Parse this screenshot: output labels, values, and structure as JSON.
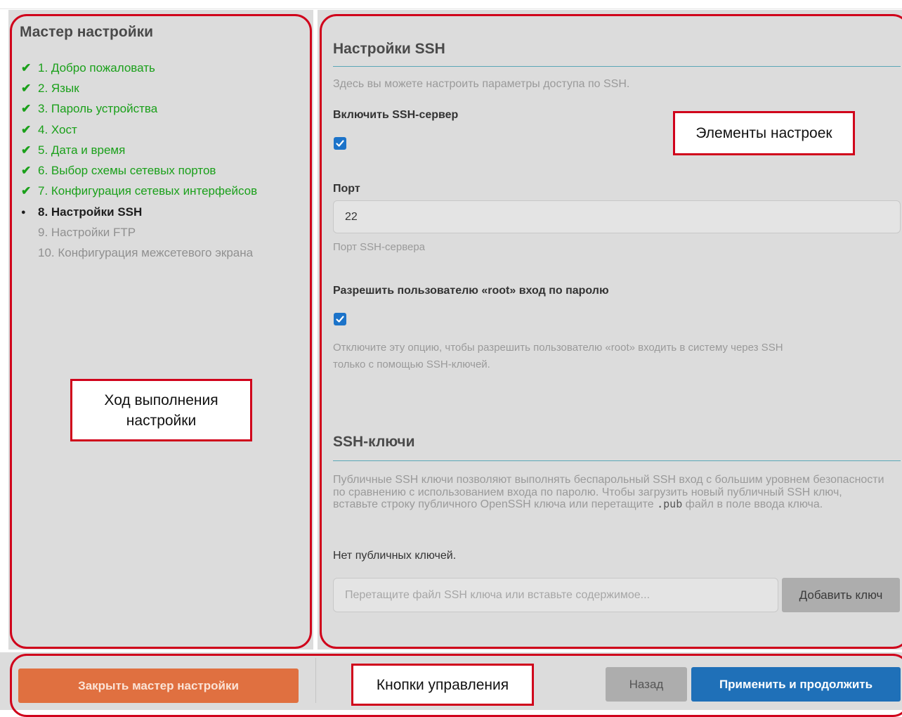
{
  "sidebar": {
    "title": "Мастер настройки",
    "steps": [
      {
        "label": "1. Добро пожаловать",
        "status": "done",
        "marker": "✔"
      },
      {
        "label": "2. Язык",
        "status": "done",
        "marker": "✔"
      },
      {
        "label": "3. Пароль устройства",
        "status": "done",
        "marker": "✔"
      },
      {
        "label": "4. Хост",
        "status": "done",
        "marker": "✔"
      },
      {
        "label": "5. Дата и время",
        "status": "done",
        "marker": "✔"
      },
      {
        "label": "6. Выбор схемы сетевых портов",
        "status": "done",
        "marker": "✔"
      },
      {
        "label": "7. Конфигурация сетевых интерфейсов",
        "status": "done",
        "marker": "✔"
      },
      {
        "label": "8. Настройки SSH",
        "status": "current",
        "marker": "●"
      },
      {
        "label": "9. Настройки FTP",
        "status": "todo",
        "marker": ""
      },
      {
        "label": "10. Конфигурация межсетевого экрана",
        "status": "todo",
        "marker": ""
      }
    ]
  },
  "ssh": {
    "title": "Настройки SSH",
    "description": "Здесь вы можете настроить параметры доступа по SSH.",
    "enable_label": "Включить SSH-сервер",
    "enable_checked": true,
    "port_label": "Порт",
    "port_value": "22",
    "port_hint": "Порт SSH-сервера",
    "root_label": "Разрешить пользователю «root» вход по паролю",
    "root_checked": true,
    "root_hint_line1": "Отключите эту опцию, чтобы разрешить пользователю «root» входить в систему через SSH",
    "root_hint_line2": "только с помощью SSH-ключей."
  },
  "keys": {
    "title": "SSH-ключи",
    "para_before": "Публичные SSH ключи позволяют выполнять беспарольный SSH вход с большим уровнем безопасности по сравнению с использованием входа по паролю. Чтобы загрузить новый публичный SSH ключ, вставьте строку публичного OpenSSH ключа или перетащите ",
    "para_code": ".pub",
    "para_after": " файл в поле ввода ключа.",
    "empty_text": "Нет публичных ключей.",
    "input_placeholder": "Перетащите файл SSH ключа или вставьте содержимое...",
    "add_button": "Добавить ключ"
  },
  "footer": {
    "close_button": "Закрыть мастер настройки",
    "back_button": "Назад",
    "apply_button": "Применить и продолжить"
  },
  "annotations": {
    "progress": "Ход выполнения настройки",
    "settings": "Элементы настроек",
    "controls": "Кнопки управления"
  },
  "colors": {
    "done": "#1aa01a",
    "accent": "#1c73c9",
    "close": "#e07040",
    "highlight": "#d0021b"
  }
}
